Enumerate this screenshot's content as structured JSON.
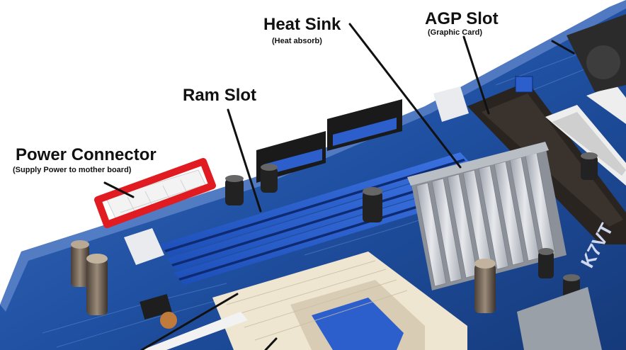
{
  "labels": {
    "power_connector": {
      "title": "Power Connector",
      "subtitle": "(Supply Power to mother board)"
    },
    "ram_slot": {
      "title": "Ram Slot"
    },
    "heat_sink": {
      "title": "Heat Sink",
      "subtitle": "(Heat  absorb)"
    },
    "agp_slot": {
      "title": "AGP Slot",
      "subtitle": "(Graphic Card)"
    }
  },
  "board_marking": "K7VT",
  "colors": {
    "pcb": "#1f4fa0",
    "ram_slot": "#2a5fd0",
    "highlight_box": "#e11b22",
    "label_text": "#111111",
    "heatsink": "#c9ccd3"
  }
}
